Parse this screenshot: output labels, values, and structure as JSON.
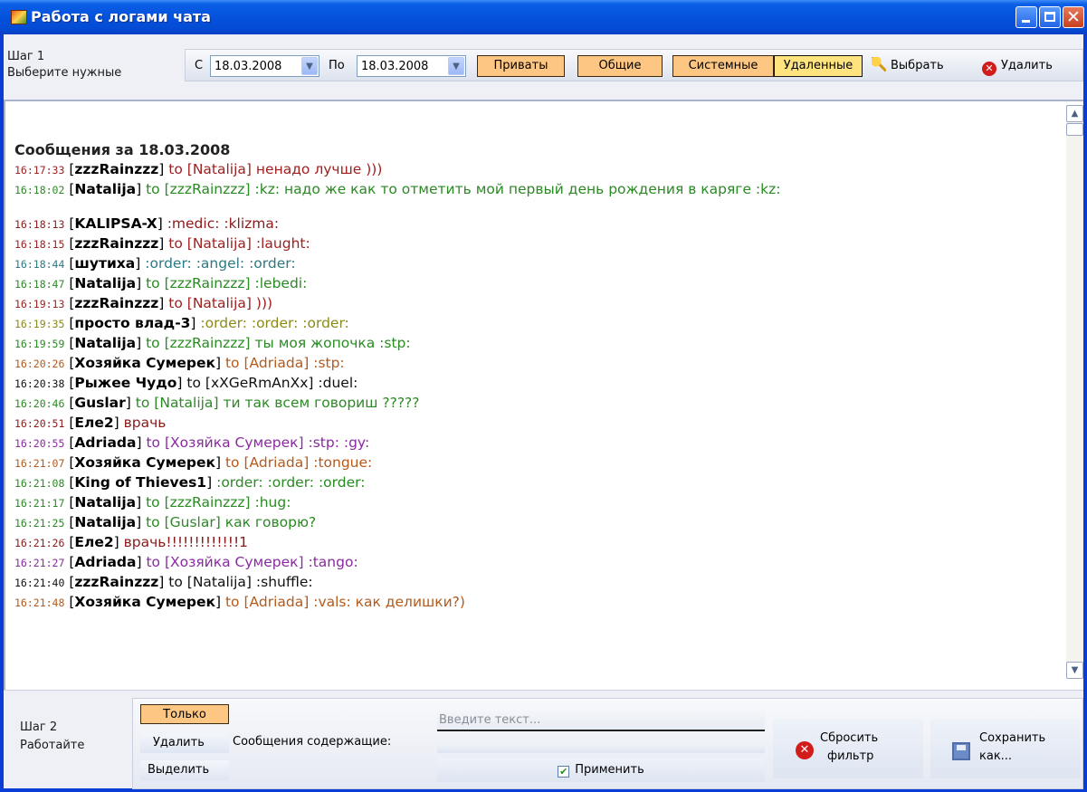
{
  "window": {
    "title": "Работа с логами чата"
  },
  "step1": {
    "label_line1": "Шаг 1",
    "label_line2": "Выберите нужные",
    "from_label": "С",
    "from_date": "18.03.2008",
    "to_label": "По",
    "to_date": "18.03.2008",
    "filters": [
      "Приваты",
      "Общие",
      "Системные",
      "Удаленные"
    ],
    "select_label": "Выбрать",
    "delete_label": "Удалить"
  },
  "log": {
    "day_header": "Сообщения за 18.03.2008",
    "messages": [
      {
        "time": "16:17:33",
        "from": "zzzRainzzz",
        "to": "Natalija",
        "text": "ненадо лучше )))",
        "color": "#a02020"
      },
      {
        "time": "16:18:02",
        "from": "Natalija",
        "to": "zzzRainzzz",
        "text": ":kz: надо же как то отметить мой первый день рождения в каряге :kz:",
        "color": "#2a8a23"
      },
      {
        "time": "16:18:13",
        "from": "KALIPSA-X",
        "to": "",
        "text": ":medic: :klizma:",
        "color": "#8b1a1a"
      },
      {
        "time": "16:18:15",
        "from": "zzzRainzzz",
        "to": "Natalija",
        "text": ":laught:",
        "color": "#a02020"
      },
      {
        "time": "16:18:44",
        "from": "шутиха",
        "to": "",
        "text": ":order: :angel: :order:",
        "color": "#2a7a84"
      },
      {
        "time": "16:18:47",
        "from": "Natalija",
        "to": "zzzRainzzz",
        "text": ":lebedi:",
        "color": "#2a8a23"
      },
      {
        "time": "16:19:13",
        "from": "zzzRainzzz",
        "to": "Natalija",
        "text": ")))",
        "color": "#a02020"
      },
      {
        "time": "16:19:35",
        "from": "просто влад-3",
        "to": "",
        "text": ":order: :order: :order:",
        "color": "#8a8a1a"
      },
      {
        "time": "16:19:59",
        "from": "Natalija",
        "to": "zzzRainzzz",
        "text": "ты моя жопочка :stp:",
        "color": "#2a8a23"
      },
      {
        "time": "16:20:26",
        "from": "Хозяйка Сумерек",
        "to": "Adriada",
        "text": ":stp:",
        "color": "#b45a1c"
      },
      {
        "time": "16:20:38",
        "from": "Рыжее Чудо",
        "to": "xXGeRmAnXx",
        "text": ":duel:",
        "color": "#111111"
      },
      {
        "time": "16:20:46",
        "from": "Guslar",
        "to": "Natalija",
        "text": "ти так всем говориш ?????",
        "color": "#2a8a23"
      },
      {
        "time": "16:20:51",
        "from": "Еле2",
        "to": "",
        "text": "врачь",
        "color": "#8b1a1a"
      },
      {
        "time": "16:20:55",
        "from": "Adriada",
        "to": "Хозяйка Сумерек",
        "text": ":stp: :gy:",
        "color": "#8a2aa0"
      },
      {
        "time": "16:21:07",
        "from": "Хозяйка Сумерек",
        "to": "Adriada",
        "text": ":tongue:",
        "color": "#b45a1c"
      },
      {
        "time": "16:21:08",
        "from": "King of Thieves1",
        "to": "",
        "text": ":order: :order: :order:",
        "color": "#2a8a23"
      },
      {
        "time": "16:21:17",
        "from": "Natalija",
        "to": "zzzRainzzz",
        "text": ":hug:",
        "color": "#2a8a23"
      },
      {
        "time": "16:21:25",
        "from": "Natalija",
        "to": "Guslar",
        "text": "как говорю?",
        "color": "#2a8a23"
      },
      {
        "time": "16:21:26",
        "from": "Еле2",
        "to": "",
        "text": "врачь!!!!!!!!!!!!!1",
        "color": "#8b1a1a"
      },
      {
        "time": "16:21:27",
        "from": "Adriada",
        "to": "Хозяйка Сумерек",
        "text": ":tango:",
        "color": "#8a2aa0"
      },
      {
        "time": "16:21:40",
        "from": "zzzRainzzz",
        "to": "Natalija",
        "text": ":shuffle:",
        "color": "#111111"
      },
      {
        "time": "16:21:48",
        "from": "Хозяйка Сумерек",
        "to": "Adriada",
        "text": ":vals: как делишки?)",
        "color": "#b45a1c"
      }
    ],
    "to_word": "to"
  },
  "step2": {
    "label_line1": "Шаг 2",
    "label_line2": "Работайте",
    "mode_only": "Только",
    "mode_delete": "Удалить",
    "mode_highlight": "Выделить",
    "contains_label": "Сообщения содержащие:",
    "search_placeholder": "Введите текст...",
    "search_value": "",
    "apply_label": "Применить",
    "reset_label_1": "Сбросить",
    "reset_label_2": "фильтр",
    "save_label_1": "Сохранить",
    "save_label_2": "как..."
  },
  "colors": {
    "title_bar": "#0552dd",
    "filter_button": "#fdc783",
    "filter_button_active": "#fee37e"
  }
}
